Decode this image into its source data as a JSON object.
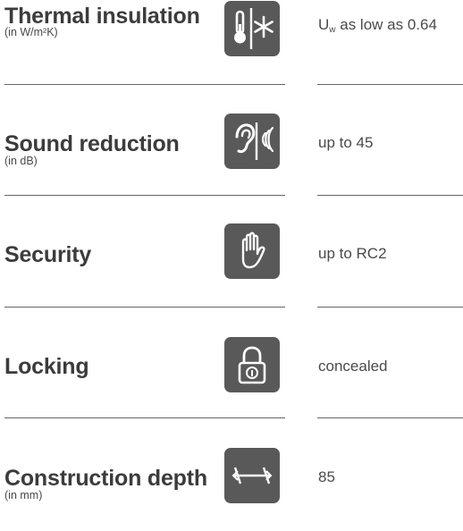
{
  "rows": [
    {
      "title": "Thermal insulation",
      "subtitle": "(in W/m²K)",
      "icon": "thermometer-snowflake-icon",
      "value_prefix": "U",
      "value_sub": "w",
      "value": " as low as 0.64"
    },
    {
      "title": "Sound reduction",
      "subtitle": "(in dB)",
      "icon": "ear-sound-icon",
      "value": "up to 45"
    },
    {
      "title": "Security",
      "subtitle": "",
      "icon": "hand-stop-icon",
      "value": "up to RC2"
    },
    {
      "title": "Locking",
      "subtitle": "",
      "icon": "padlock-icon",
      "value": "concealed"
    },
    {
      "title": "Construction depth",
      "subtitle": "(in mm)",
      "icon": "depth-arrows-icon",
      "value": "85"
    }
  ],
  "colors": {
    "icon_bg": "#595959",
    "text": "#3c3c3c",
    "divider": "#666666"
  }
}
